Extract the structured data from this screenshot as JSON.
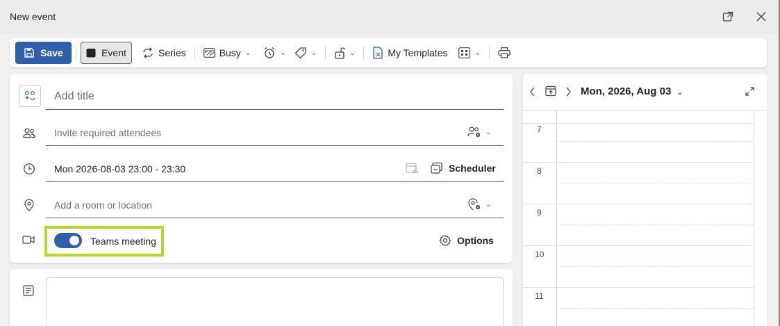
{
  "window": {
    "title": "New event"
  },
  "toolbar": {
    "save_label": "Save",
    "event_label": "Event",
    "series_label": "Series",
    "busy_label": "Busy",
    "templates_label": "My Templates"
  },
  "form": {
    "title_placeholder": "Add title",
    "attendees_placeholder": "Invite required attendees",
    "datetime_value": "Mon 2026-08-03 23:00 - 23:30",
    "scheduler_label": "Scheduler",
    "location_placeholder": "Add a room or location",
    "teams_label": "Teams meeting",
    "teams_enabled": true,
    "options_label": "Options"
  },
  "calendar": {
    "date_label": "Mon, 2026, Aug 03",
    "hours": [
      "7",
      "8",
      "9",
      "10",
      "11"
    ]
  },
  "colors": {
    "accent": "#2f5fa8",
    "highlight": "#b5d62a"
  }
}
